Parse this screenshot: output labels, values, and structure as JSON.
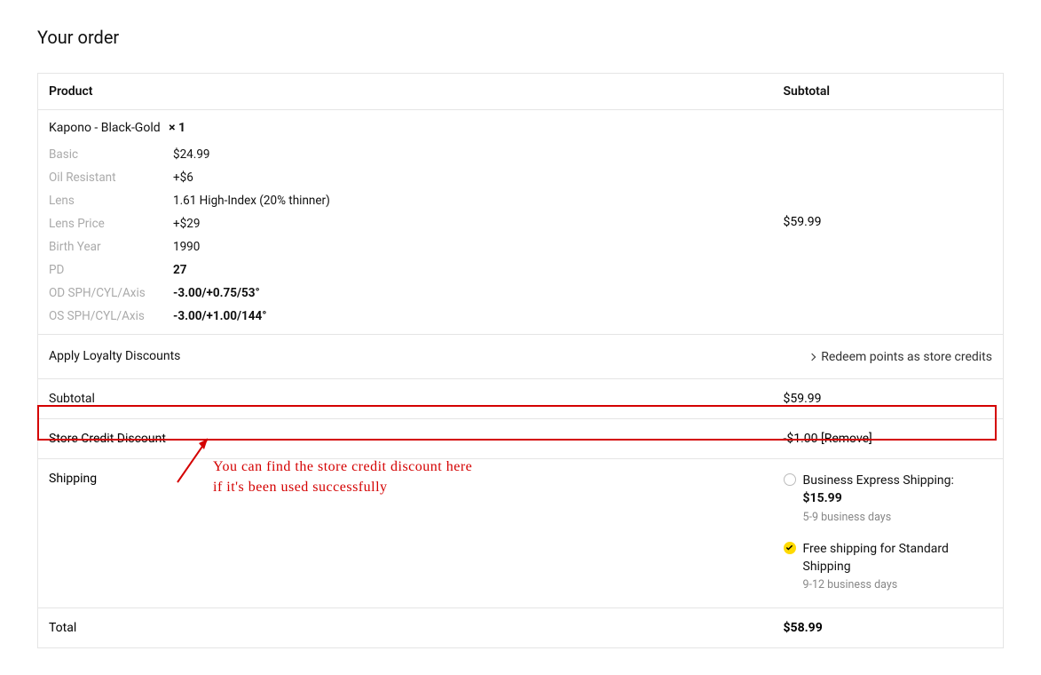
{
  "page_title": "Your order",
  "headers": {
    "product": "Product",
    "subtotal": "Subtotal"
  },
  "product": {
    "name": "Kapono - Black-Gold",
    "qty_prefix": "× ",
    "qty": "1",
    "subtotal": "$59.99",
    "attrs": {
      "basic": {
        "label": "Basic",
        "value": "$24.99"
      },
      "oil": {
        "label": "Oil Resistant",
        "value": "+$6"
      },
      "lens": {
        "label": "Lens",
        "value": "1.61 High-Index (20% thinner)"
      },
      "lens_price": {
        "label": "Lens Price",
        "value": "+$29"
      },
      "birth_year": {
        "label": "Birth Year",
        "value": "1990"
      },
      "pd": {
        "label": "PD",
        "value": "27"
      },
      "od": {
        "label": "OD SPH/CYL/Axis",
        "value": "-3.00/+0.75/53°"
      },
      "os": {
        "label": "OS SPH/CYL/Axis",
        "value": "-3.00/+1.00/144°"
      }
    }
  },
  "loyalty": {
    "label": "Apply Loyalty Discounts",
    "redeem_text": "Redeem points as store credits"
  },
  "subtotal": {
    "label": "Subtotal",
    "value": "$59.99"
  },
  "store_credit": {
    "label": "Store Credit Discount",
    "value": "-$1.00 ",
    "remove": "[Remove]"
  },
  "shipping": {
    "label": "Shipping",
    "opts": {
      "express": {
        "name": "Business Express Shipping: ",
        "price": "$15.99",
        "note": "5-9 business days",
        "selected": false
      },
      "free": {
        "name": "Free shipping for Standard Shipping",
        "price": "",
        "note": "9-12 business days",
        "selected": true
      }
    }
  },
  "total": {
    "label": "Total",
    "value": "$58.99"
  },
  "annotation": {
    "line1": "You can find the store credit discount here",
    "line2": "if it's been used successfully"
  }
}
